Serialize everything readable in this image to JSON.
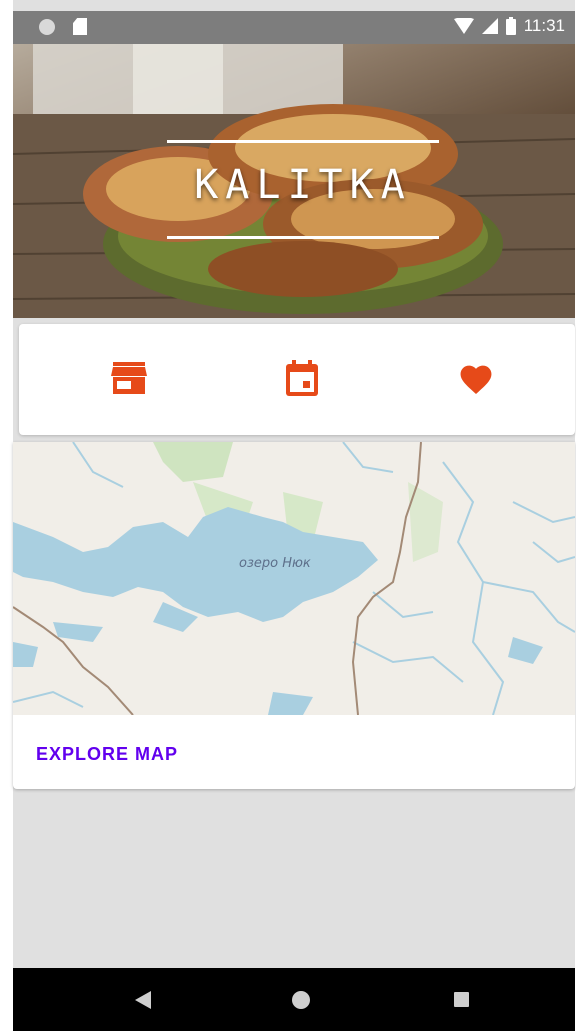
{
  "status_bar": {
    "time": "11:31",
    "icons": [
      "notification-dot-icon",
      "sd-card-icon",
      "wifi-icon",
      "signal-icon",
      "battery-icon"
    ]
  },
  "hero": {
    "title": "KALITKA",
    "image": "kalitka-pastries-photo"
  },
  "actions": {
    "accent_color": "#e64a19",
    "items": [
      {
        "icon": "store-icon"
      },
      {
        "icon": "calendar-icon"
      },
      {
        "icon": "heart-icon"
      }
    ]
  },
  "map": {
    "label": "озеро Нюк",
    "explore_label": "EXPLORE MAP",
    "explore_color": "#6200ee"
  },
  "nav_bar": {
    "icons": [
      "back-icon",
      "home-icon",
      "recents-icon"
    ]
  }
}
